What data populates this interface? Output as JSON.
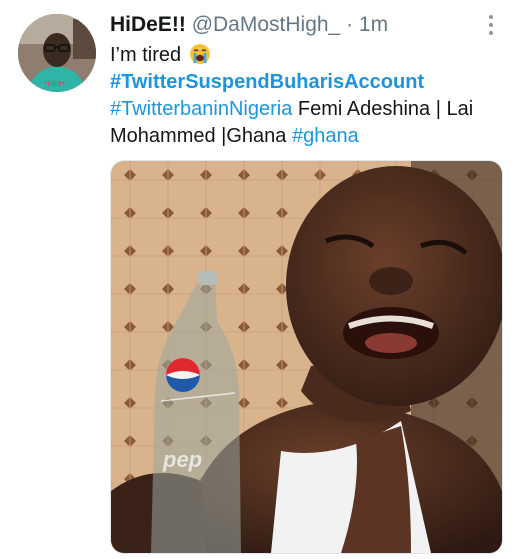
{
  "tweet": {
    "author": {
      "display_name": "HiDeE!!",
      "handle": "@DaMostHigh_",
      "separator": "·",
      "time": "1m"
    },
    "text_line1": "I’m tired",
    "emoji": "crying-face",
    "hashtag_primary": "#TwitterSuspendBuharisAccount",
    "hashtag_secondary": "#TwitterbaninNigeria",
    "text_mid": " Femi Adeshina | Lai",
    "text_line4_a": "Mohammed |Ghana ",
    "hashtag_ghana": "#ghana",
    "bottle_label": "pep"
  },
  "colors": {
    "link": "#1b95e0",
    "muted": "#657786",
    "text": "#14171a"
  },
  "icons": [
    "avatar",
    "crying-emoji-icon",
    "more-options-icon",
    "pepsi-logo"
  ]
}
